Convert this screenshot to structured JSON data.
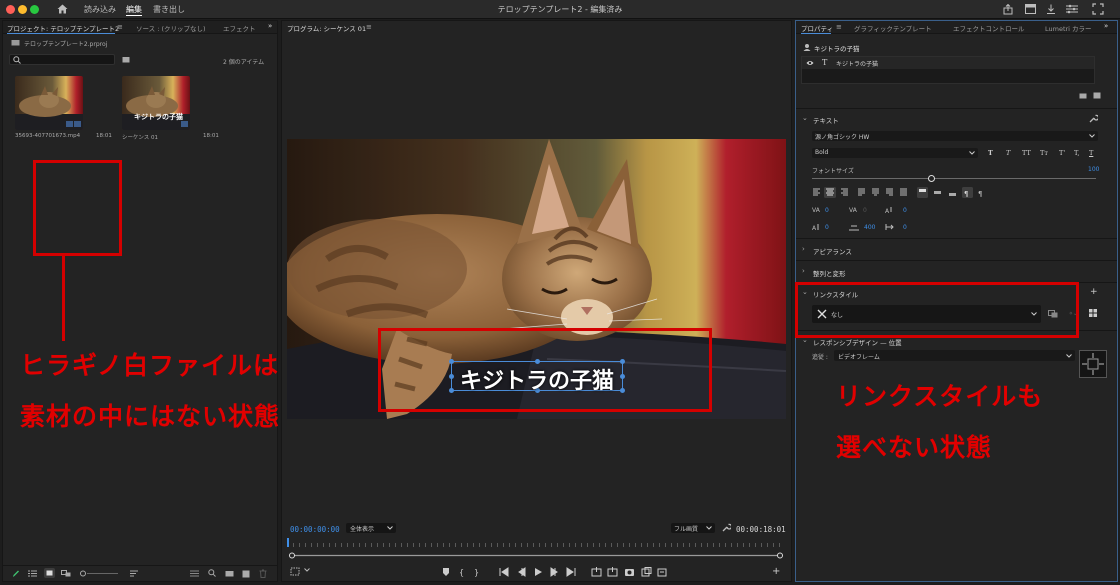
{
  "titlebar": {
    "menu": [
      "読み込み",
      "編集",
      "書き出し"
    ],
    "title": "テロップテンプレート2 - 編集済み",
    "colors": {
      "close": "#ff5f57",
      "minimize": "#febc2e",
      "maximize": "#28c840"
    }
  },
  "project": {
    "tabs": [
      "プロジェクト: テロップテンプレート2",
      "ソース : (クリップなし)",
      "エフェクト"
    ],
    "filename": "テロップテンプレート2.prproj",
    "item_count": "2 個のアイテム",
    "items": [
      {
        "name": "35693-407701673.mp4",
        "duration": "18:01",
        "overlay": ""
      },
      {
        "name": "シーケンス 01",
        "duration": "18:01",
        "overlay": "キジトラの子猫"
      }
    ]
  },
  "program": {
    "tab": "プログラム: シーケンス 01",
    "caption": "キジトラの子猫",
    "timecode": "00:00:00:00",
    "zoom": "全体表示",
    "quality": "フル画質",
    "duration": "00:00:18:01",
    "playhead_fraction": 0.0
  },
  "properties": {
    "tabs": [
      "プロパティ",
      "グラフィックテンプレート",
      "エフェクトコントロール",
      "Lumetri カラー"
    ],
    "clip_name": "キジトラの子猫",
    "layer_name": "キジトラの子猫",
    "text_section": "テキスト",
    "font": "源ノ角ゴシック HW",
    "weight": "Bold",
    "style_buttons": [
      "T",
      "T",
      "TT",
      "Tт",
      "T'",
      "T,",
      "T"
    ],
    "font_size_label": "フォントサイズ",
    "font_size": "100",
    "font_size_fraction": 0.42,
    "metrics": {
      "kerning": "0",
      "tracking": "0",
      "baseline": "0",
      "leading": "0",
      "tsume": "400",
      "tab": "0"
    },
    "appearance": "アピアランス",
    "align": "整列と変形",
    "link_style": "リンクスタイル",
    "link_value": "なし",
    "responsive": "レスポンシブデザイン — 位置",
    "follow_label": "追従 :",
    "follow_value": "ビデオフレーム"
  },
  "annotations": {
    "left_line1": "ヒラギノ白ファイルは",
    "left_line2": "素材の中にはない状態",
    "right_line1": "リンクスタイルも",
    "right_line2": "選べない状態",
    "color": "#e10000"
  }
}
